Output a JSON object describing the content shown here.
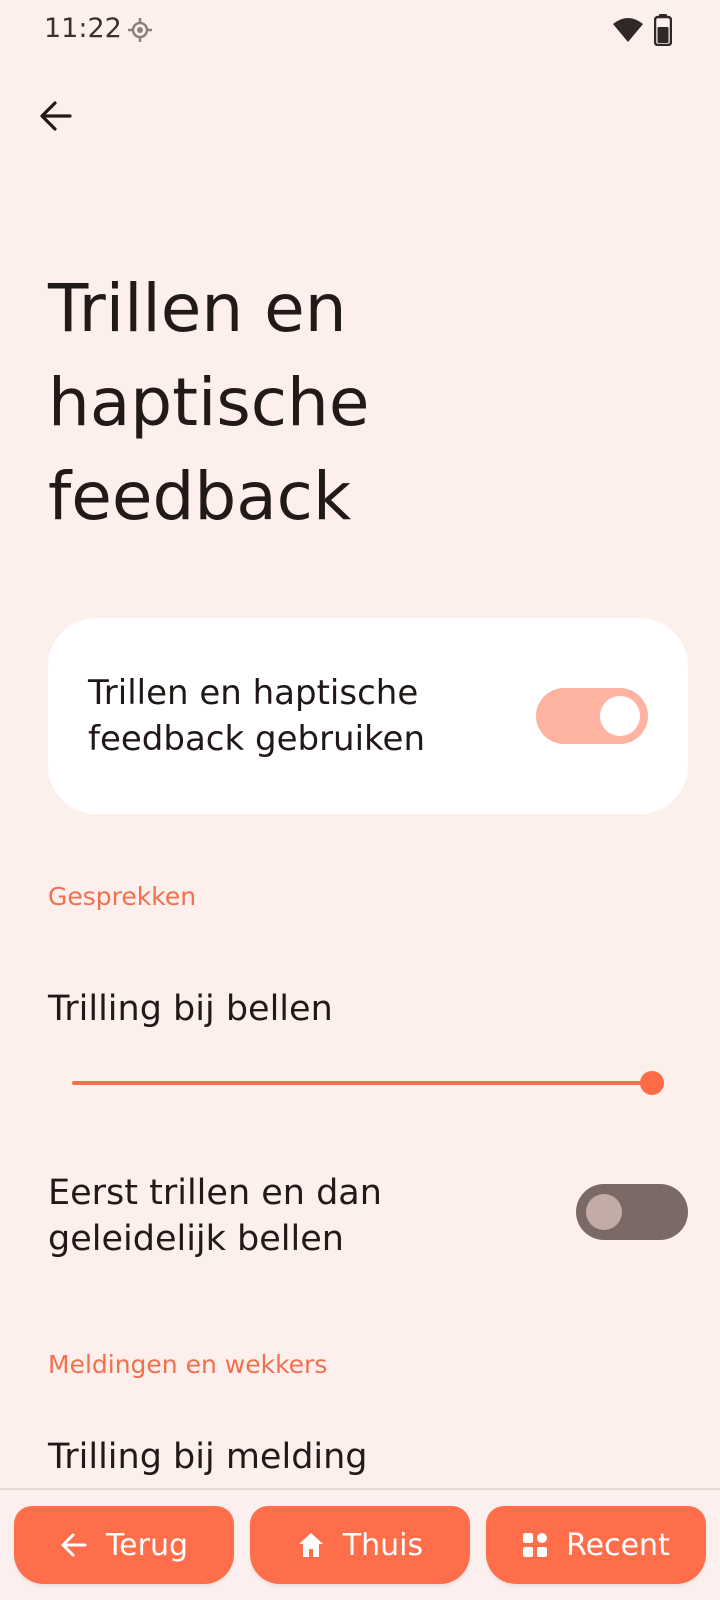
{
  "status_bar": {
    "time": "11:22",
    "icons": [
      "location-icon",
      "wifi-icon",
      "battery-icon"
    ]
  },
  "header": {
    "back_icon": "arrow-left-icon"
  },
  "page": {
    "title": "Trillen en haptische feedback"
  },
  "master_switch": {
    "label": "Trillen en haptische feedback gebruiken",
    "checked": true
  },
  "sections": {
    "calls": {
      "header": "Gesprekken",
      "ring_vibration": {
        "title": "Trilling bij bellen",
        "level": 1.0
      },
      "ramping_ringer": {
        "title": "Eerst trillen en dan geleidelijk bellen",
        "checked": false
      }
    },
    "notifications": {
      "header": "Meldingen en wekkers",
      "notification_vibration": {
        "title": "Trilling bij melding"
      }
    }
  },
  "nav_bar": {
    "back_label": "Terug",
    "home_label": "Thuis",
    "recent_label": "Recent"
  },
  "colors": {
    "background": "#fcefec",
    "accent": "#f0704f",
    "nav_button": "#ff6e4a",
    "toggle_on_track": "#ffb4a2",
    "toggle_off_track": "#7a6965"
  }
}
